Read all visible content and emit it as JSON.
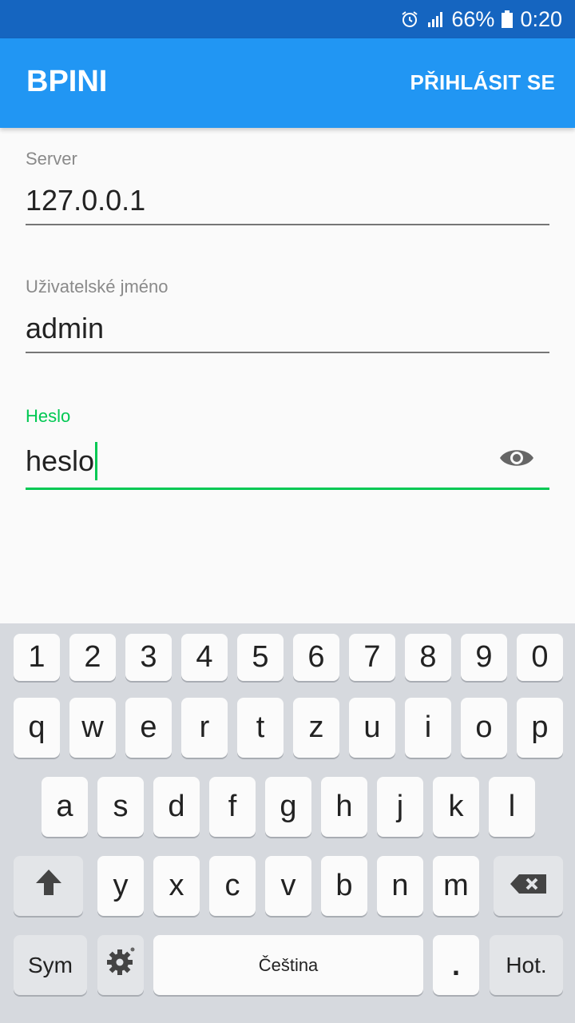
{
  "status_bar": {
    "battery": "66%",
    "time": "0:20",
    "icons": [
      "alarm-icon",
      "signal-icon",
      "battery-icon"
    ]
  },
  "app_bar": {
    "title": "BPINI",
    "action": "PŘIHLÁSIT SE"
  },
  "form": {
    "server": {
      "label": "Server",
      "value": "127.0.0.1"
    },
    "username": {
      "label": "Uživatelské jméno",
      "value": "admin"
    },
    "password": {
      "label": "Heslo",
      "value": "heslo"
    }
  },
  "keyboard": {
    "numbers": [
      "1",
      "2",
      "3",
      "4",
      "5",
      "6",
      "7",
      "8",
      "9",
      "0"
    ],
    "row1": [
      "q",
      "w",
      "e",
      "r",
      "t",
      "z",
      "u",
      "i",
      "o",
      "p"
    ],
    "row2": [
      "a",
      "s",
      "d",
      "f",
      "g",
      "h",
      "j",
      "k",
      "l"
    ],
    "row3": [
      "y",
      "x",
      "c",
      "v",
      "b",
      "n",
      "m"
    ],
    "sym": "Sym",
    "space": "Čeština",
    "dot": ".",
    "hot": "Hot."
  },
  "colors": {
    "status_bar": "#1565c0",
    "app_bar": "#2196f3",
    "accent": "#00c853",
    "keyboard_bg": "#d6d9de"
  }
}
